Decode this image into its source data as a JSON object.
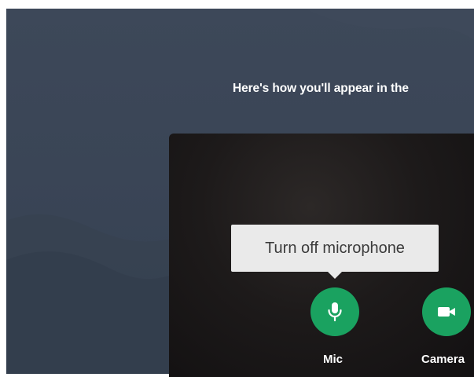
{
  "preview": {
    "heading": "Here's how you'll appear in the"
  },
  "tooltip": {
    "text": "Turn off microphone"
  },
  "controls": {
    "mic": {
      "label": "Mic",
      "icon": "microphone-icon",
      "state": "on"
    },
    "camera": {
      "label": "Camera",
      "icon": "video-camera-icon",
      "state": "on"
    }
  },
  "colors": {
    "background": "#3a4556",
    "button_active": "#1aa260",
    "tooltip_bg": "#eaeaea",
    "tooltip_text": "#3b3b3b"
  }
}
